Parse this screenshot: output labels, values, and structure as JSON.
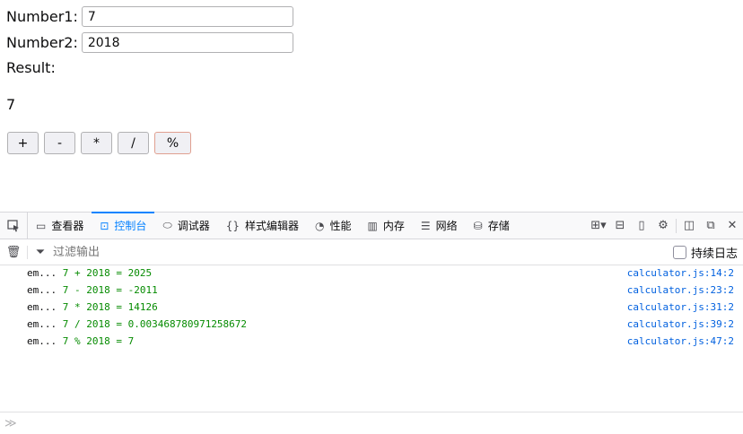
{
  "calculator": {
    "number1_label": "Number1:",
    "number1_value": "7",
    "number2_label": "Number2:",
    "number2_value": "2018",
    "result_label": "Result:",
    "result_value": "7",
    "buttons": [
      "+",
      "-",
      "*",
      "/",
      "%"
    ]
  },
  "devtools": {
    "tabs": [
      {
        "label": "查看器",
        "icon": "inspector-icon"
      },
      {
        "label": "控制台",
        "icon": "console-icon"
      },
      {
        "label": "调试器",
        "icon": "debugger-icon"
      },
      {
        "label": "样式编辑器",
        "icon": "style-editor-icon"
      },
      {
        "label": "性能",
        "icon": "performance-icon"
      },
      {
        "label": "内存",
        "icon": "memory-icon"
      },
      {
        "label": "网络",
        "icon": "network-icon"
      },
      {
        "label": "存储",
        "icon": "storage-icon"
      }
    ],
    "active_tab": "控制台",
    "filter_placeholder": "过滤输出",
    "persist_logs_label": "持续日志",
    "logs": [
      {
        "prefix": "em... ",
        "text": "7 + 2018 = 2025",
        "location": "calculator.js:14:2"
      },
      {
        "prefix": "em... ",
        "text": "7 - 2018 = -2011",
        "location": "calculator.js:23:2"
      },
      {
        "prefix": "em... ",
        "text": "7 * 2018 = 14126",
        "location": "calculator.js:31:2"
      },
      {
        "prefix": "em... ",
        "text": "7 / 2018 = 0.003468780971258672",
        "location": "calculator.js:39:2"
      },
      {
        "prefix": "em... ",
        "text": "7 % 2018 = 7",
        "location": "calculator.js:47:2"
      }
    ],
    "colors": {
      "accent": "#0a84ff",
      "log_value": "#058b00",
      "link": "#0060df"
    }
  }
}
